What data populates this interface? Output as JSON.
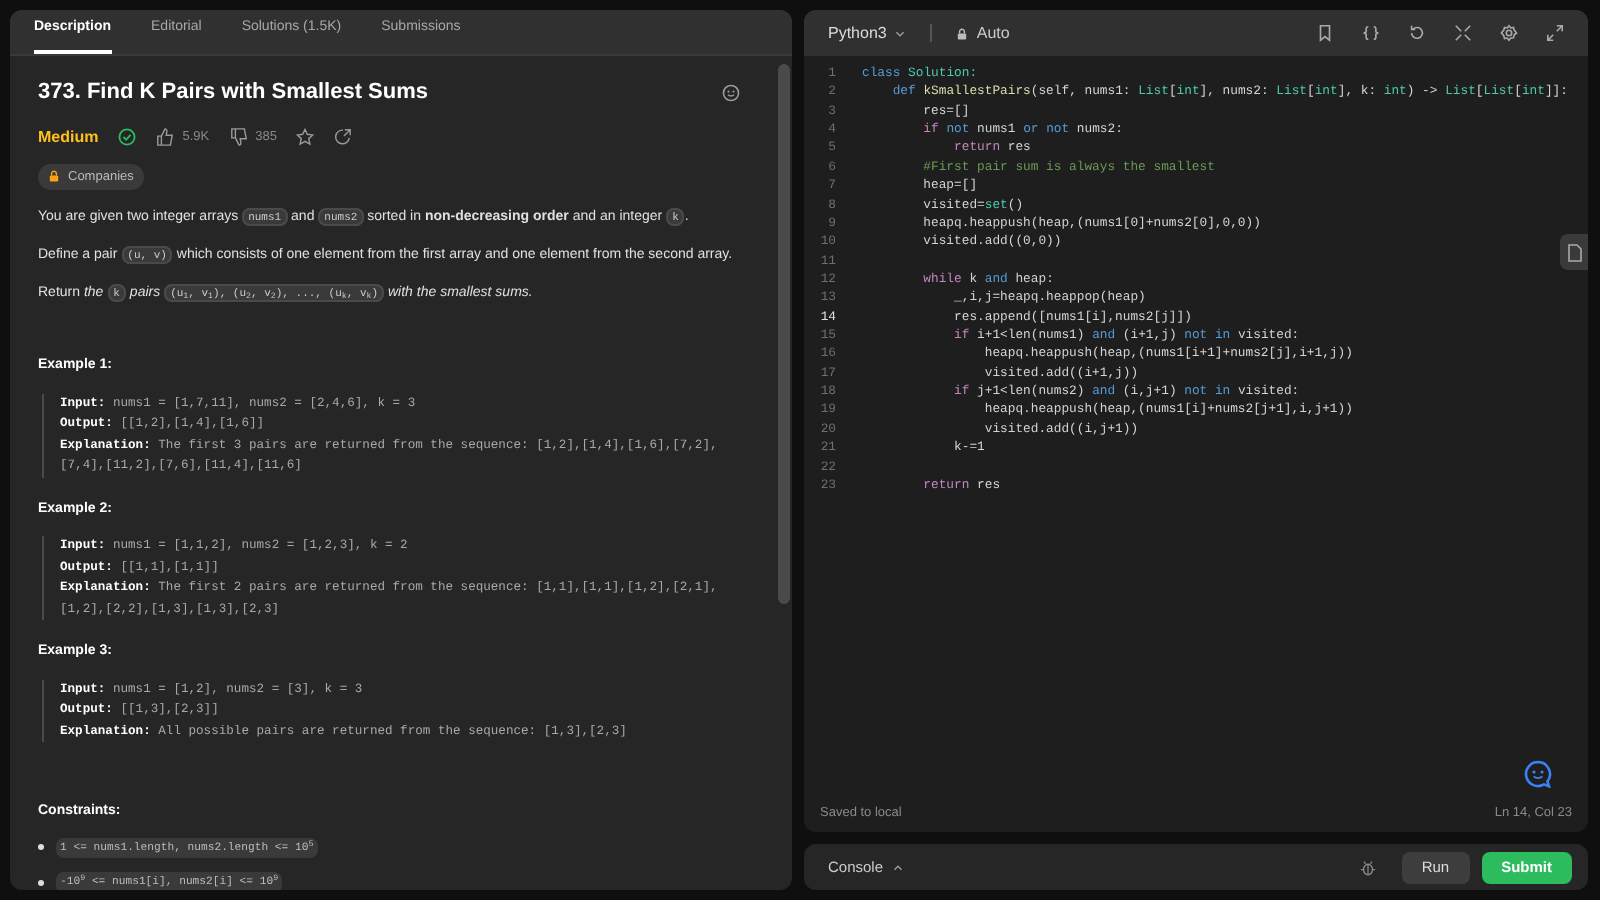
{
  "tabs": [
    {
      "label": "Description",
      "selected": true
    },
    {
      "label": "Editorial",
      "selected": false
    },
    {
      "label": "Solutions (1.5K)",
      "selected": false
    },
    {
      "label": "Submissions",
      "selected": false
    }
  ],
  "problem": {
    "title": "373. Find K Pairs with Smallest Sums",
    "difficulty": "Medium",
    "solved": true,
    "likes": "5.9K",
    "dislikes": "385",
    "companies": "Companies",
    "paragraphs": [
      [
        {
          "kind": "text",
          "text": "You are given two integer arrays "
        },
        {
          "kind": "code",
          "text": "nums1"
        },
        {
          "kind": "text",
          "text": " and "
        },
        {
          "kind": "code",
          "text": "nums2"
        },
        {
          "kind": "text",
          "text": " sorted in **non-decreasing order** and an integer "
        },
        {
          "kind": "code",
          "text": "k"
        },
        {
          "kind": "text",
          "text": "."
        }
      ],
      [
        {
          "kind": "text",
          "text": "Define a pair "
        },
        {
          "kind": "code",
          "text": "(u, v)"
        },
        {
          "kind": "text",
          "text": " which consists of one element from the first array and one element from the second array."
        }
      ],
      [
        {
          "kind": "text",
          "text": "Return *the* "
        },
        {
          "kind": "code",
          "text": "k"
        },
        {
          "kind": "text",
          "text": " *pairs* "
        },
        {
          "kind": "code",
          "text": "(u$_{1}$, v$_{1}$), (u$_{2}$, v$_{2}$), ..., (u$_{k}$, v$_{k}$)"
        },
        {
          "kind": "text",
          "text": " *with the smallest sums.*"
        }
      ]
    ],
    "examples": [
      {
        "heading": "Example 1:",
        "lines": [
          {
            "label": "Input:",
            "value": "nums1 = [1,7,11], nums2 = [2,4,6], k = 3"
          },
          {
            "label": "Output:",
            "value": "[[1,2],[1,4],[1,6]]"
          },
          {
            "label": "Explanation:",
            "value": "The first 3 pairs are returned from the sequence: [1,2],[1,4],[1,6],[7,2],[7,4],[11,2],[7,6],[11,4],[11,6]"
          }
        ]
      },
      {
        "heading": "Example 2:",
        "lines": [
          {
            "label": "Input:",
            "value": "nums1 = [1,1,2], nums2 = [1,2,3], k = 2"
          },
          {
            "label": "Output:",
            "value": "[[1,1],[1,1]]"
          },
          {
            "label": "Explanation:",
            "value": "The first 2 pairs are returned from the sequence: [1,1],[1,1],[1,2],[2,1],[1,2],[2,2],[1,3],[1,3],[2,3]"
          }
        ]
      },
      {
        "heading": "Example 3:",
        "lines": [
          {
            "label": "Input:",
            "value": "nums1 = [1,2], nums2 = [3], k = 3"
          },
          {
            "label": "Output:",
            "value": "[[1,3],[2,3]]"
          },
          {
            "label": "Explanation:",
            "value": "All possible pairs are returned from the sequence: [1,3],[2,3]"
          }
        ]
      }
    ],
    "constraints_heading": "Constraints:",
    "constraints": [
      "1 <= nums1.length, nums2.length <= 10$^{5}$",
      "-10$^{9}$ <= nums1[i], nums2[i] <= 10$^{9}$"
    ]
  },
  "editor": {
    "language": "Python3",
    "mode": "Auto",
    "lines": [
      {
        "number": "1",
        "current": false,
        "tokens": [
          {
            "kind": "keyword",
            "text": "class"
          },
          {
            "kind": "type",
            "text": " Solution:"
          }
        ]
      },
      {
        "number": "2",
        "current": false,
        "tokens": [
          {
            "kind": "keyword",
            "text": "    def"
          },
          {
            "kind": "function",
            "text": " kSmallestPairs"
          },
          {
            "kind": "plain",
            "text": "(self, nums1: "
          },
          {
            "kind": "type",
            "text": "List"
          },
          {
            "kind": "plain",
            "text": "["
          },
          {
            "kind": "type",
            "text": "int"
          },
          {
            "kind": "plain",
            "text": "], nums2: "
          },
          {
            "kind": "type",
            "text": "List"
          },
          {
            "kind": "plain",
            "text": "["
          },
          {
            "kind": "type",
            "text": "int"
          },
          {
            "kind": "plain",
            "text": "], k: "
          },
          {
            "kind": "type",
            "text": "int"
          },
          {
            "kind": "plain",
            "text": ") -> "
          },
          {
            "kind": "type",
            "text": "List"
          },
          {
            "kind": "plain",
            "text": "["
          },
          {
            "kind": "type",
            "text": "List"
          },
          {
            "kind": "plain",
            "text": "["
          },
          {
            "kind": "type",
            "text": "int"
          },
          {
            "kind": "plain",
            "text": "]]:"
          }
        ]
      },
      {
        "number": "3",
        "current": false,
        "tokens": [
          {
            "kind": "plain",
            "text": "        res=[]"
          }
        ]
      },
      {
        "number": "4",
        "current": false,
        "tokens": [
          {
            "kind": "control",
            "text": "        if"
          },
          {
            "kind": "keyword",
            "text": " not"
          },
          {
            "kind": "plain",
            "text": " nums1 "
          },
          {
            "kind": "keyword",
            "text": "or not"
          },
          {
            "kind": "plain",
            "text": " nums2:"
          }
        ]
      },
      {
        "number": "5",
        "current": false,
        "tokens": [
          {
            "kind": "control",
            "text": "            return"
          },
          {
            "kind": "plain",
            "text": " res"
          }
        ]
      },
      {
        "number": "6",
        "current": false,
        "tokens": [
          {
            "kind": "comment",
            "text": "        #First pair sum is always the smallest"
          }
        ]
      },
      {
        "number": "7",
        "current": false,
        "tokens": [
          {
            "kind": "plain",
            "text": "        heap=[]"
          }
        ]
      },
      {
        "number": "8",
        "current": false,
        "tokens": [
          {
            "kind": "plain",
            "text": "        visited="
          },
          {
            "kind": "type",
            "text": "set"
          },
          {
            "kind": "plain",
            "text": "()"
          }
        ]
      },
      {
        "number": "9",
        "current": false,
        "tokens": [
          {
            "kind": "plain",
            "text": "        heapq.heappush(heap,(nums1[0]+nums2[0],0,0))"
          }
        ]
      },
      {
        "number": "10",
        "current": false,
        "tokens": [
          {
            "kind": "plain",
            "text": "        visited.add((0,0))"
          }
        ]
      },
      {
        "number": "11",
        "current": false
      },
      {
        "number": "12",
        "current": false,
        "tokens": [
          {
            "kind": "control",
            "text": "        while"
          },
          {
            "kind": "plain",
            "text": " k "
          },
          {
            "kind": "keyword",
            "text": "and"
          },
          {
            "kind": "plain",
            "text": " heap:"
          }
        ]
      },
      {
        "number": "13",
        "current": false,
        "tokens": [
          {
            "kind": "plain",
            "text": "            _,i,j=heapq.heappop(heap)"
          }
        ]
      },
      {
        "number": "14",
        "current": true,
        "tokens": [
          {
            "kind": "plain",
            "text": "            res.append([nums1[i],nums2[j]])"
          }
        ]
      },
      {
        "number": "15",
        "current": false,
        "tokens": [
          {
            "kind": "control",
            "text": "            if"
          },
          {
            "kind": "plain",
            "text": " i+1<len(nums1) "
          },
          {
            "kind": "keyword",
            "text": "and"
          },
          {
            "kind": "plain",
            "text": " (i+1,j) "
          },
          {
            "kind": "keyword",
            "text": "not in"
          },
          {
            "kind": "plain",
            "text": " visited:"
          }
        ]
      },
      {
        "number": "16",
        "current": false,
        "tokens": [
          {
            "kind": "plain",
            "text": "                heapq.heappush(heap,(nums1[i+1]+nums2[j],i+1,j))"
          }
        ]
      },
      {
        "number": "17",
        "current": false,
        "tokens": [
          {
            "kind": "plain",
            "text": "                visited.add((i+1,j))"
          }
        ]
      },
      {
        "number": "18",
        "current": false,
        "tokens": [
          {
            "kind": "control",
            "text": "            if"
          },
          {
            "kind": "plain",
            "text": " j+1<len(nums2) "
          },
          {
            "kind": "keyword",
            "text": "and"
          },
          {
            "kind": "plain",
            "text": " (i,j+1) "
          },
          {
            "kind": "keyword",
            "text": "not in"
          },
          {
            "kind": "plain",
            "text": " visited:"
          }
        ]
      },
      {
        "number": "19",
        "current": false,
        "tokens": [
          {
            "kind": "plain",
            "text": "                heapq.heappush(heap,(nums1[i]+nums2[j+1],i,j+1))"
          }
        ]
      },
      {
        "number": "20",
        "current": false,
        "tokens": [
          {
            "kind": "plain",
            "text": "                visited.add((i,j+1))"
          }
        ]
      },
      {
        "number": "21",
        "current": false,
        "tokens": [
          {
            "kind": "plain",
            "text": "            k-=1"
          }
        ]
      },
      {
        "number": "22",
        "current": false
      },
      {
        "number": "23",
        "current": false,
        "tokens": [
          {
            "kind": "control",
            "text": "        return"
          },
          {
            "kind": "plain",
            "text": " res"
          }
        ]
      }
    ],
    "save_status": "Saved to local",
    "cursor": "Ln 14, Col 23"
  },
  "console": {
    "label": "Console",
    "run": "Run",
    "submit": "Submit"
  }
}
